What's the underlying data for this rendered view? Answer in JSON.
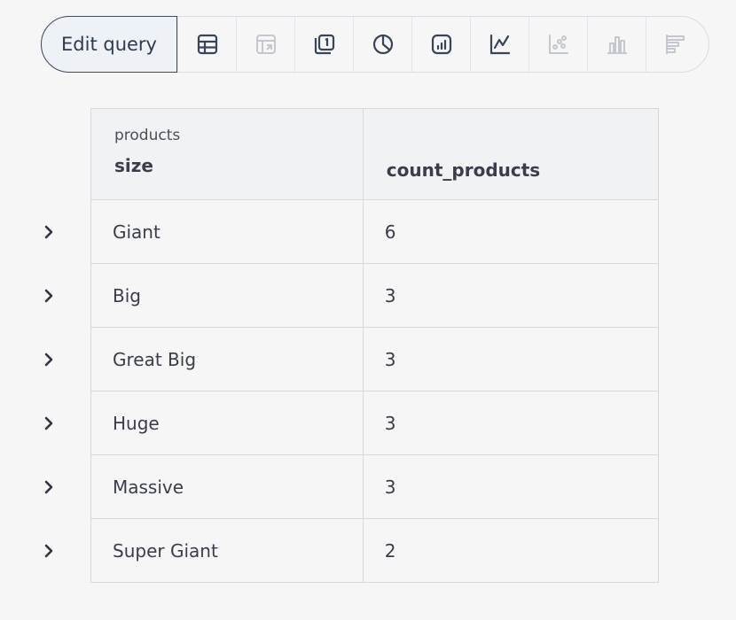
{
  "toolbar": {
    "edit_label": "Edit query",
    "tools": [
      {
        "name": "table-icon",
        "enabled": true
      },
      {
        "name": "pivot-table-icon",
        "enabled": false
      },
      {
        "name": "single-value-icon",
        "enabled": true
      },
      {
        "name": "pie-chart-icon",
        "enabled": true
      },
      {
        "name": "bar-kpi-icon",
        "enabled": true
      },
      {
        "name": "line-chart-icon",
        "enabled": true
      },
      {
        "name": "scatter-chart-icon",
        "enabled": false
      },
      {
        "name": "column-chart-icon",
        "enabled": false
      },
      {
        "name": "horizontal-bar-chart-icon",
        "enabled": false
      }
    ]
  },
  "table": {
    "columns": [
      {
        "group": "products",
        "label": "size"
      },
      {
        "group": "",
        "label": "count_products"
      }
    ],
    "rows": [
      {
        "size": "Giant",
        "count": "6"
      },
      {
        "size": "Big",
        "count": "3"
      },
      {
        "size": "Great Big",
        "count": "3"
      },
      {
        "size": "Huge",
        "count": "3"
      },
      {
        "size": "Massive",
        "count": "3"
      },
      {
        "size": "Super Giant",
        "count": "2"
      }
    ]
  }
}
